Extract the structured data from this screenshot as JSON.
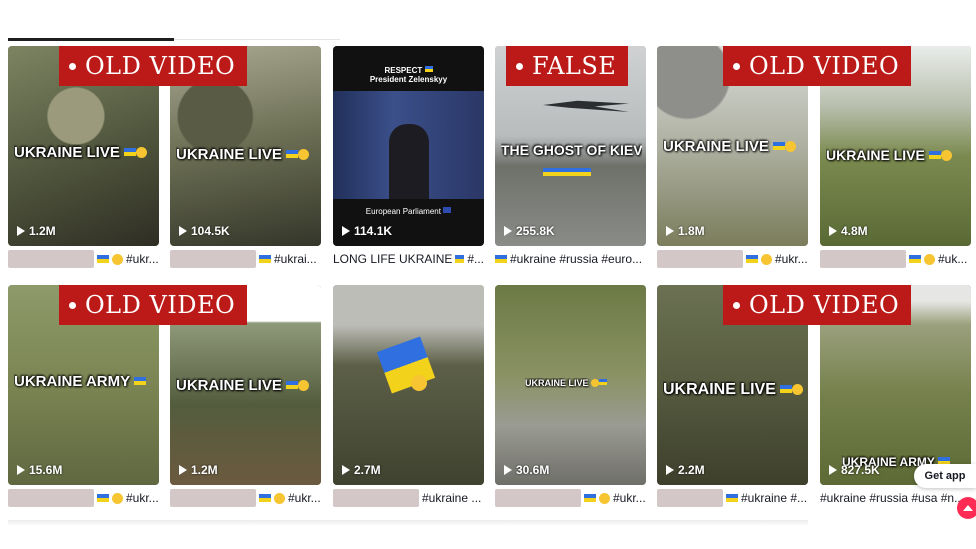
{
  "badges": {
    "old_video": "OLD VIDEO",
    "false": "FALSE"
  },
  "row1": [
    {
      "overlay": "UKRAINE LIVE",
      "views": "1.2M",
      "caption": "#ukr..."
    },
    {
      "overlay": "UKRAINE LIVE",
      "views": "104.5K",
      "caption": "#ukrai..."
    },
    {
      "overlay_top1": "RESPECT",
      "overlay_top2": "President Zelenskyy",
      "overlay_bottom": "European Parliament",
      "views": "114.1K",
      "caption": "LONG LIFE UKRAINE",
      "caption_tail": "#..."
    },
    {
      "overlay": "THE GHOST OF KIEV",
      "views": "255.8K",
      "caption": "#ukraine #russia #euro..."
    },
    {
      "overlay": "UKRAINE LIVE",
      "views": "1.8M",
      "caption": "#ukr..."
    },
    {
      "overlay": "UKRAINE LIVE",
      "views": "4.8M",
      "caption": "#uk..."
    }
  ],
  "row2": [
    {
      "overlay": "UKRAINE ARMY",
      "views": "15.6M",
      "caption": "#ukr..."
    },
    {
      "overlay": "UKRAINE LIVE",
      "views": "1.2M",
      "caption": "#ukr..."
    },
    {
      "overlay": "",
      "views": "2.7M",
      "caption": "#ukraine ..."
    },
    {
      "overlay": "UKRAINE LIVE",
      "views": "30.6M",
      "caption": "#ukr..."
    },
    {
      "overlay": "UKRAINE LIVE",
      "views": "2.2M",
      "caption": "#ukraine #..."
    },
    {
      "overlay": "UKRAINE ARMY",
      "views": "827.5K",
      "caption": "#ukraine #russia #usa #n..."
    }
  ],
  "get_app": "Get app",
  "colors": {
    "badge": "#bb1a18",
    "scroll_top": "#fe2c55"
  }
}
